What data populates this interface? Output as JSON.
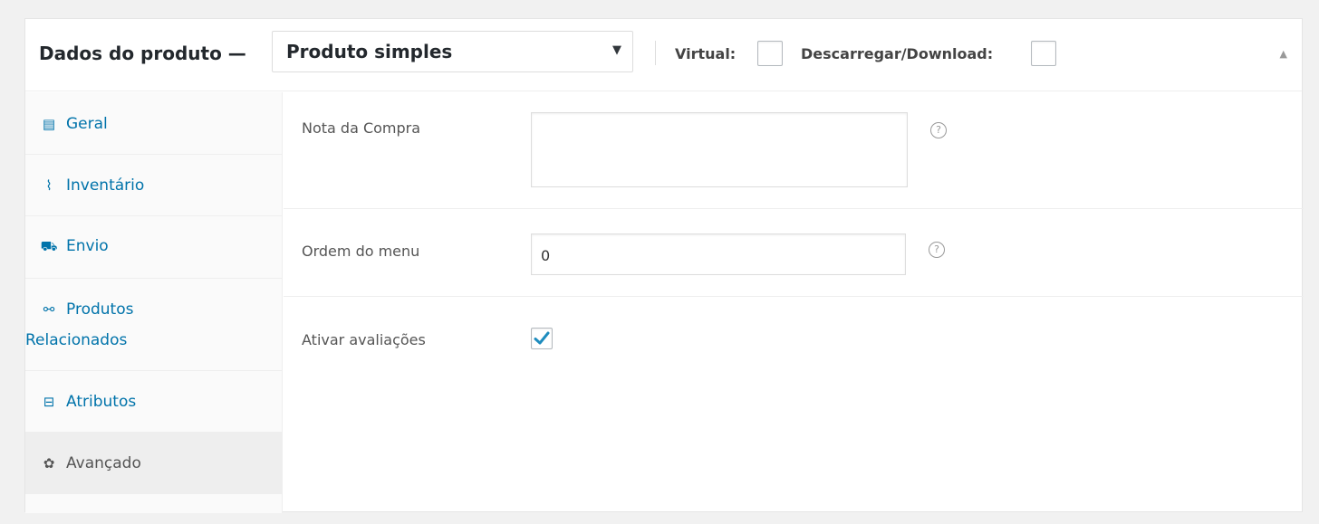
{
  "header": {
    "title": "Dados do produto —",
    "product_type": "Produto simples",
    "select_arrow": "▼",
    "virtual_label": "Virtual:",
    "download_label": "Descarregar/Download:",
    "virtual_checked": false,
    "download_checked": false,
    "collapse_glyph": "▲"
  },
  "sidebar": {
    "items": [
      {
        "label": "Geral",
        "icon": "grid-icon",
        "glyph": "▤"
      },
      {
        "label": "Inventário",
        "icon": "inventory-chart-icon",
        "glyph": "⌇"
      },
      {
        "label": "Envio",
        "icon": "truck-icon",
        "glyph": "⛟"
      },
      {
        "label_line1": "Produtos",
        "label_line2": "Relacionados",
        "icon": "link-icon",
        "glyph": "⚯"
      },
      {
        "label": "Atributos",
        "icon": "attributes-icon",
        "glyph": "⊟"
      },
      {
        "label": "Avançado",
        "icon": "gear-icon",
        "glyph": "✿",
        "active": true
      }
    ]
  },
  "fields": {
    "purchase_note_label": "Nota da Compra",
    "purchase_note_value": "",
    "menu_order_label": "Ordem do menu",
    "menu_order_value": "0",
    "reviews_label": "Ativar avaliações",
    "reviews_checked": true,
    "help_glyph": "?"
  },
  "colors": {
    "link": "#0073aa",
    "checkmark": "#1e8cbe",
    "active_tab_bg": "#eeeeee"
  }
}
